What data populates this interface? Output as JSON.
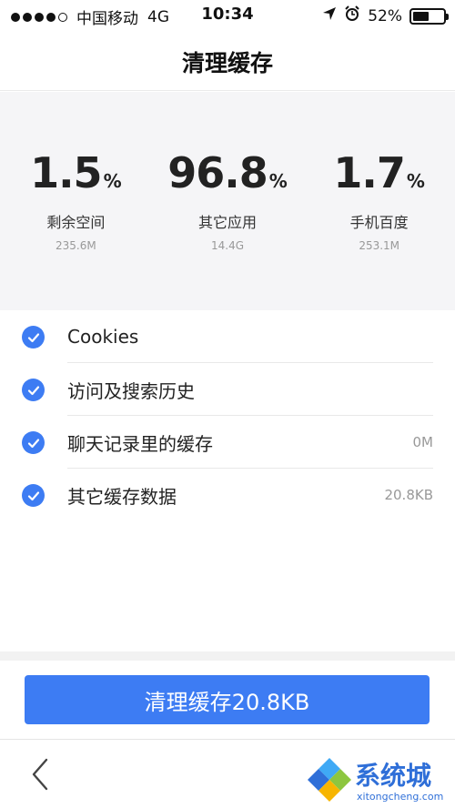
{
  "status_bar": {
    "carrier": "中国移动",
    "network": "4G",
    "time": "10:34",
    "battery": "52%",
    "battery_level": 0.52,
    "signal_icon": "signal-dots-icon",
    "location_icon": "location-arrow-icon",
    "alarm_icon": "alarm-clock-icon"
  },
  "header": {
    "title": "清理缓存"
  },
  "stats": [
    {
      "value": "1.5",
      "unit": "%",
      "label": "剩余空间",
      "size": "235.6M"
    },
    {
      "value": "96.8",
      "unit": "%",
      "label": "其它应用",
      "size": "14.4G"
    },
    {
      "value": "1.7",
      "unit": "%",
      "label": "手机百度",
      "size": "253.1M"
    }
  ],
  "items": [
    {
      "label": "Cookies",
      "value": "",
      "checked": true
    },
    {
      "label": "访问及搜索历史",
      "value": "",
      "checked": true
    },
    {
      "label": "聊天记录里的缓存",
      "value": "0M",
      "checked": true
    },
    {
      "label": "其它缓存数据",
      "value": "20.8KB",
      "checked": true
    }
  ],
  "clean_button": {
    "label": "清理缓存20.8KB"
  },
  "nav": {
    "back_icon": "chevron-left-icon"
  },
  "watermark": {
    "title": "系统城",
    "url": "xitongcheng.com"
  },
  "colors": {
    "accent": "#3d7cf3",
    "panel_bg": "#f5f5f7"
  }
}
